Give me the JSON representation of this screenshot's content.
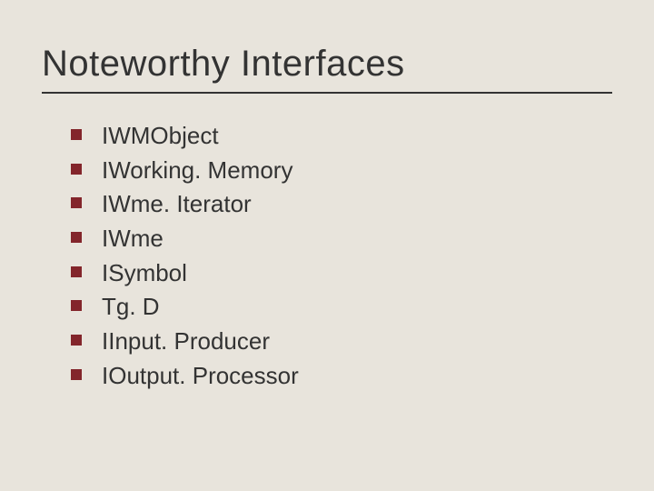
{
  "title": "Noteworthy Interfaces",
  "items": [
    "IWMObject",
    "IWorking. Memory",
    "IWme. Iterator",
    "IWme",
    "ISymbol",
    "Tg. D",
    "IInput. Producer",
    "IOutput. Processor"
  ]
}
